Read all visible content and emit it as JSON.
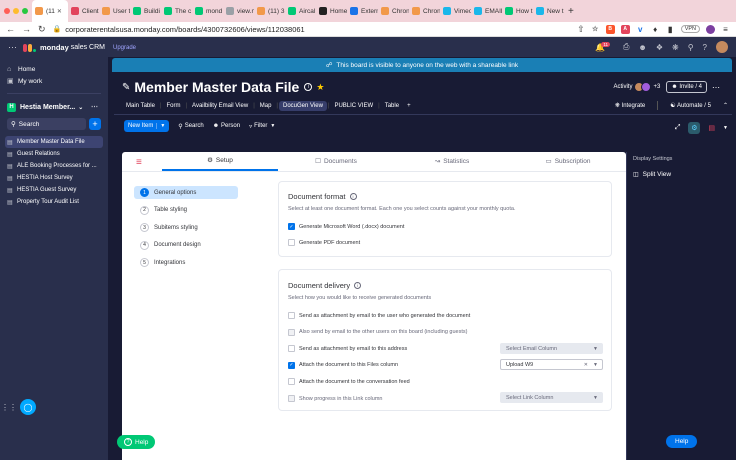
{
  "browser": {
    "tabs": [
      {
        "label": "(11",
        "color": "#f2994a",
        "active": true
      },
      {
        "label": "Client",
        "color": "#e2445c"
      },
      {
        "label": "User t",
        "color": "#f2994a"
      },
      {
        "label": "Buildi",
        "color": "#00c875"
      },
      {
        "label": "The c",
        "color": "#00c875"
      },
      {
        "label": "mond",
        "color": "#00c875"
      },
      {
        "label": "view.n",
        "color": "#9aa0a6"
      },
      {
        "label": "(11) 3",
        "color": "#f2994a"
      },
      {
        "label": "Aircal",
        "color": "#00c875"
      },
      {
        "label": "Home",
        "color": "#222222"
      },
      {
        "label": "Extern",
        "color": "#1a73e8"
      },
      {
        "label": "Chron",
        "color": "#f2994a"
      },
      {
        "label": "Chron",
        "color": "#f2994a"
      },
      {
        "label": "Vimeo",
        "color": "#1ab7ea"
      },
      {
        "label": "EMAIL",
        "color": "#1ab7ea"
      },
      {
        "label": "How t",
        "color": "#00c875"
      },
      {
        "label": "New t",
        "color": "#1ab7ea"
      }
    ],
    "url": "corporaterentalsusa.monday.com/boards/4300732606/views/112038061",
    "vpn": "VPN"
  },
  "topbar": {
    "brand": "monday",
    "brand_suffix": "sales CRM",
    "upgrade": "Upgrade",
    "notif_count": "11"
  },
  "sidebar": {
    "home": "Home",
    "mywork": "My work",
    "workspace": "Hestia Member...",
    "workspace_badge": "H",
    "search": "Search",
    "boards": [
      {
        "label": "Member Master Data File",
        "active": true
      },
      {
        "label": "Guest Relations"
      },
      {
        "label": "ALE Booking Processes for ..."
      },
      {
        "label": "HESTIA Host Survey"
      },
      {
        "label": "HESTIA Guest Survey"
      },
      {
        "label": "Property Tour Audit List"
      }
    ]
  },
  "banner": "This board is visible to anyone on the web with a shareable link",
  "board": {
    "title": "Member Master Data File",
    "activity": "Activity",
    "avatar_extra": "+3",
    "invite": "Invite / 4",
    "views": [
      "Main Table",
      "Form",
      "Availbility Email View",
      "Map",
      "DocuGen View",
      "PUBLIC VIEW",
      "Table"
    ],
    "active_view": "DocuGen View",
    "integrate": "Integrate",
    "automate": "Automate / 5"
  },
  "toolbar": {
    "new_item": "New Item",
    "search": "Search",
    "person": "Person",
    "filter": "Filter"
  },
  "docugen": {
    "tabs": [
      "Setup",
      "Documents",
      "Statistics",
      "Subscription"
    ],
    "steps": [
      {
        "num": "1",
        "label": "General options"
      },
      {
        "num": "2",
        "label": "Table styling"
      },
      {
        "num": "3",
        "label": "Subitems styling"
      },
      {
        "num": "4",
        "label": "Document design"
      },
      {
        "num": "5",
        "label": "Integrations"
      }
    ],
    "format": {
      "title": "Document format",
      "subtitle": "Select at least one document format. Each one you select counts against your monthly quota.",
      "options": [
        {
          "label": "Generate Microsoft Word (.docx) document",
          "checked": true
        },
        {
          "label": "Generate PDF document",
          "checked": false
        }
      ]
    },
    "delivery": {
      "title": "Document delivery",
      "subtitle": "Select how you would like to receive generated documents",
      "options": [
        {
          "label": "Send as attachment by email to the user who generated the document",
          "checked": false,
          "disabled": false
        },
        {
          "label": "Also send by email to the other users on this board (including guests)",
          "checked": false,
          "disabled": true
        },
        {
          "label": "Send as attachment by email to this address",
          "checked": false,
          "disabled": false
        },
        {
          "label": "Attach the document to this Files column",
          "checked": true,
          "disabled": false
        },
        {
          "label": "Attach the document to the conversation feed",
          "checked": false,
          "disabled": false
        },
        {
          "label": "Show progress in this Link column",
          "checked": false,
          "disabled": true
        }
      ],
      "select_email": "Select Email Column",
      "select_files": "Upload W9",
      "select_link": "Select Link Column"
    }
  },
  "settings": {
    "title": "Display Settings",
    "split_view": "Split View"
  },
  "help_green": "Help",
  "help_blue": "Help",
  "colors": {
    "accent": "#0073ea",
    "dark_bg": "#292f4c",
    "board_bg": "#181b34",
    "banner": "#1a7fb5",
    "green": "#00c875"
  }
}
